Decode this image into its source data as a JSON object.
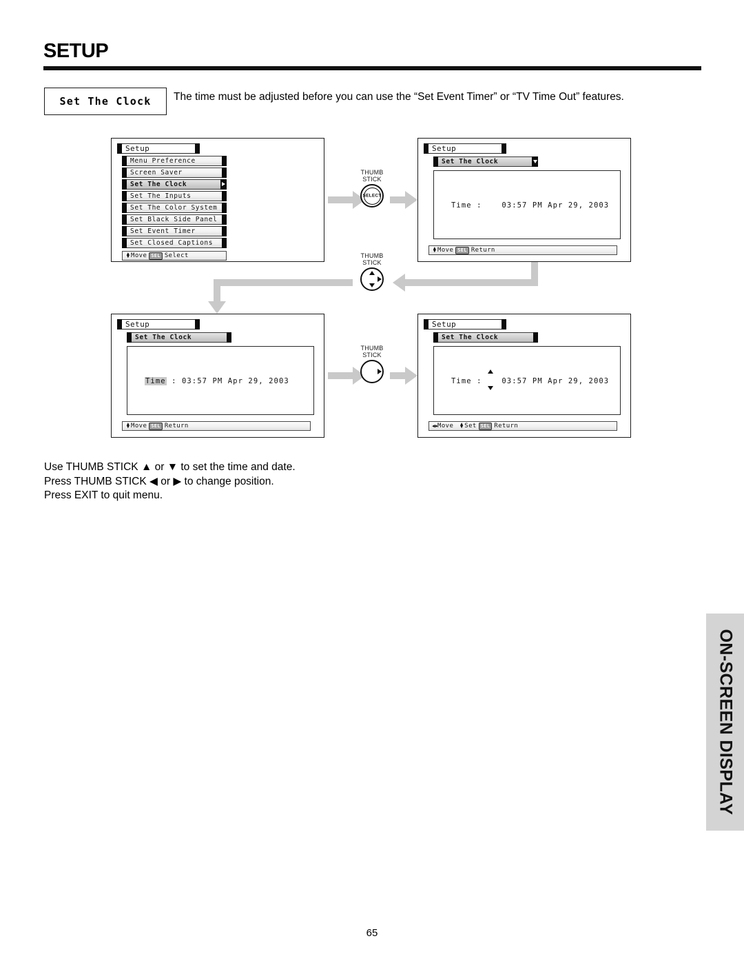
{
  "header": {
    "title": "SETUP"
  },
  "feature": {
    "label": "Set The Clock",
    "intro": "The time must be adjusted before you can use the “Set Event Timer” or “TV Time Out” features."
  },
  "panels": {
    "top_left": {
      "window_title": "Setup",
      "menu_items": [
        {
          "label": "Menu Preference",
          "selected": false
        },
        {
          "label": "Screen Saver",
          "selected": false
        },
        {
          "label": "Set The Clock",
          "selected": true
        },
        {
          "label": "Set The Inputs",
          "selected": false
        },
        {
          "label": "Set The Color System",
          "selected": false
        },
        {
          "label": "Set Black Side Panel",
          "selected": false
        },
        {
          "label": "Set Event Timer",
          "selected": false
        },
        {
          "label": "Set Closed Captions",
          "selected": false
        }
      ],
      "footer": {
        "move_label": "Move",
        "sel_key": "SEL",
        "action_label": "Select"
      }
    },
    "top_right": {
      "window_title": "Setup",
      "sub_title": "Set The Clock",
      "time_label": "Time :",
      "time_value": "03:57 PM Apr 29, 2003",
      "footer": {
        "move_label": "Move",
        "sel_key": "SEL",
        "action_label": "Return"
      }
    },
    "bottom_left": {
      "window_title": "Setup",
      "sub_title": "Set The Clock",
      "time_label": "Time",
      "time_value": ":   03:57 PM Apr 29, 2003",
      "footer": {
        "move_label": "Move",
        "sel_key": "SEL",
        "action_label": "Return"
      }
    },
    "bottom_right": {
      "window_title": "Setup",
      "sub_title": "Set The Clock",
      "time_label": "Time :",
      "time_value": "03:57 PM Apr 29, 2003",
      "footer": {
        "move_label": "Move",
        "set_label": "Set",
        "sel_key": "SEL",
        "action_label": "Return"
      }
    }
  },
  "thumb_sticks": [
    {
      "line1": "THUMB",
      "line2": "STICK",
      "center": "SELECT"
    },
    {
      "line1": "THUMB",
      "line2": "STICK",
      "center": ""
    },
    {
      "line1": "THUMB",
      "line2": "STICK",
      "center": ""
    }
  ],
  "instructions": {
    "line1": "Use THUMB STICK ▲ or ▼ to set the time and date.",
    "line2": "Press THUMB STICK ◀ or ▶ to change position.",
    "line3": "Press EXIT to quit menu."
  },
  "side_tab": {
    "text": "ON-SCREEN DISPLAY",
    "background": "#d4d4d4"
  },
  "footer": {
    "page_number": "65"
  }
}
